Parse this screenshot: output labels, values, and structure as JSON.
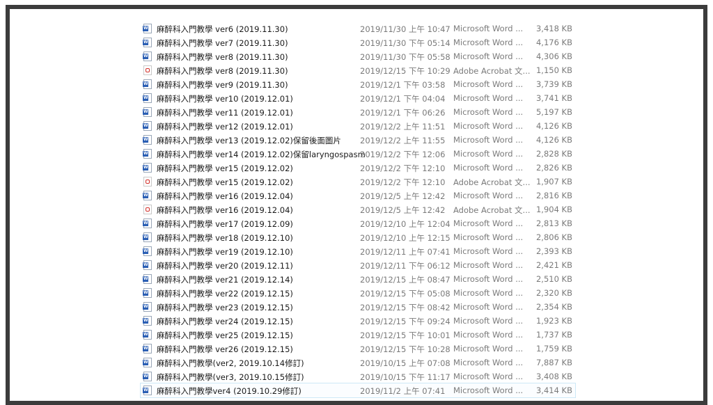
{
  "files": [
    {
      "icon": "word",
      "name": "麻醉科入門教學 ver6 (2019.11.30)",
      "date": "2019/11/30 上午 10:47",
      "type": "Microsoft Word ...",
      "size": "3,418 KB"
    },
    {
      "icon": "word",
      "name": "麻醉科入門教學 ver7 (2019.11.30)",
      "date": "2019/11/30 下午 05:14",
      "type": "Microsoft Word ...",
      "size": "4,176 KB"
    },
    {
      "icon": "word",
      "name": "麻醉科入門教學 ver8 (2019.11.30)",
      "date": "2019/11/30 下午 05:58",
      "type": "Microsoft Word ...",
      "size": "4,306 KB"
    },
    {
      "icon": "pdf",
      "name": "麻醉科入門教學 ver8 (2019.11.30)",
      "date": "2019/12/15 下午 10:29",
      "type": "Adobe Acrobat 文...",
      "size": "1,150 KB"
    },
    {
      "icon": "word",
      "name": "麻醉科入門教學 ver9 (2019.11.30)",
      "date": "2019/12/1 下午 03:58",
      "type": "Microsoft Word ...",
      "size": "3,739 KB"
    },
    {
      "icon": "word",
      "name": "麻醉科入門教學 ver10 (2019.12.01)",
      "date": "2019/12/1 下午 04:04",
      "type": "Microsoft Word ...",
      "size": "3,741 KB"
    },
    {
      "icon": "word",
      "name": "麻醉科入門教學 ver11 (2019.12.01)",
      "date": "2019/12/1 下午 06:26",
      "type": "Microsoft Word ...",
      "size": "5,197 KB"
    },
    {
      "icon": "word",
      "name": "麻醉科入門教學 ver12 (2019.12.01)",
      "date": "2019/12/2 上午 11:51",
      "type": "Microsoft Word ...",
      "size": "4,126 KB"
    },
    {
      "icon": "word",
      "name": "麻醉科入門教學 ver13 (2019.12.02)保留後面圖片",
      "date": "2019/12/2 上午 11:55",
      "type": "Microsoft Word ...",
      "size": "4,126 KB"
    },
    {
      "icon": "word",
      "name": "麻醉科入門教學 ver14 (2019.12.02)保留laryngospasm",
      "date": "2019/12/2 下午 12:06",
      "type": "Microsoft Word ...",
      "size": "2,828 KB"
    },
    {
      "icon": "word",
      "name": "麻醉科入門教學 ver15 (2019.12.02)",
      "date": "2019/12/2 下午 12:10",
      "type": "Microsoft Word ...",
      "size": "2,826 KB"
    },
    {
      "icon": "pdf",
      "name": "麻醉科入門教學 ver15 (2019.12.02)",
      "date": "2019/12/2 下午 12:10",
      "type": "Adobe Acrobat 文...",
      "size": "1,907 KB"
    },
    {
      "icon": "word",
      "name": "麻醉科入門教學 ver16 (2019.12.04)",
      "date": "2019/12/5 上午 12:42",
      "type": "Microsoft Word ...",
      "size": "2,816 KB"
    },
    {
      "icon": "pdf",
      "name": "麻醉科入門教學 ver16 (2019.12.04)",
      "date": "2019/12/5 上午 12:42",
      "type": "Adobe Acrobat 文...",
      "size": "1,904 KB"
    },
    {
      "icon": "word",
      "name": "麻醉科入門教學 ver17 (2019.12.09)",
      "date": "2019/12/10 上午 12:04",
      "type": "Microsoft Word ...",
      "size": "2,813 KB"
    },
    {
      "icon": "word",
      "name": "麻醉科入門教學 ver18 (2019.12.10)",
      "date": "2019/12/10 上午 12:15",
      "type": "Microsoft Word ...",
      "size": "2,806 KB"
    },
    {
      "icon": "word",
      "name": "麻醉科入門教學 ver19 (2019.12.10)",
      "date": "2019/12/11 上午 07:41",
      "type": "Microsoft Word ...",
      "size": "2,393 KB"
    },
    {
      "icon": "word",
      "name": "麻醉科入門教學 ver20 (2019.12.11)",
      "date": "2019/12/11 下午 06:12",
      "type": "Microsoft Word ...",
      "size": "2,421 KB"
    },
    {
      "icon": "word",
      "name": "麻醉科入門教學 ver21 (2019.12.14)",
      "date": "2019/12/15 上午 08:47",
      "type": "Microsoft Word ...",
      "size": "2,510 KB"
    },
    {
      "icon": "word",
      "name": "麻醉科入門教學 ver22 (2019.12.15)",
      "date": "2019/12/15 下午 05:08",
      "type": "Microsoft Word ...",
      "size": "2,320 KB"
    },
    {
      "icon": "word",
      "name": "麻醉科入門教學 ver23 (2019.12.15)",
      "date": "2019/12/15 下午 08:42",
      "type": "Microsoft Word ...",
      "size": "2,354 KB"
    },
    {
      "icon": "word",
      "name": "麻醉科入門教學 ver24 (2019.12.15)",
      "date": "2019/12/15 下午 09:24",
      "type": "Microsoft Word ...",
      "size": "1,923 KB"
    },
    {
      "icon": "word",
      "name": "麻醉科入門教學 ver25 (2019.12.15)",
      "date": "2019/12/15 下午 10:01",
      "type": "Microsoft Word ...",
      "size": "1,737 KB"
    },
    {
      "icon": "word",
      "name": "麻醉科入門教學 ver26 (2019.12.15)",
      "date": "2019/12/15 下午 10:28",
      "type": "Microsoft Word ...",
      "size": "1,759 KB"
    },
    {
      "icon": "word",
      "name": "麻醉科入門教學(ver2, 2019.10.14修訂)",
      "date": "2019/10/15 上午 07:08",
      "type": "Microsoft Word ...",
      "size": "7,887 KB"
    },
    {
      "icon": "word",
      "name": "麻醉科入門教學(ver3, 2019.10.15修訂)",
      "date": "2019/10/15 下午 11:17",
      "type": "Microsoft Word ...",
      "size": "3,408 KB"
    },
    {
      "icon": "word",
      "name": "麻醉科入門教學ver4 (2019.10.29修訂)",
      "date": "2019/11/2 上午 07:41",
      "type": "Microsoft Word ...",
      "size": "3,414 KB",
      "selected": true
    }
  ]
}
